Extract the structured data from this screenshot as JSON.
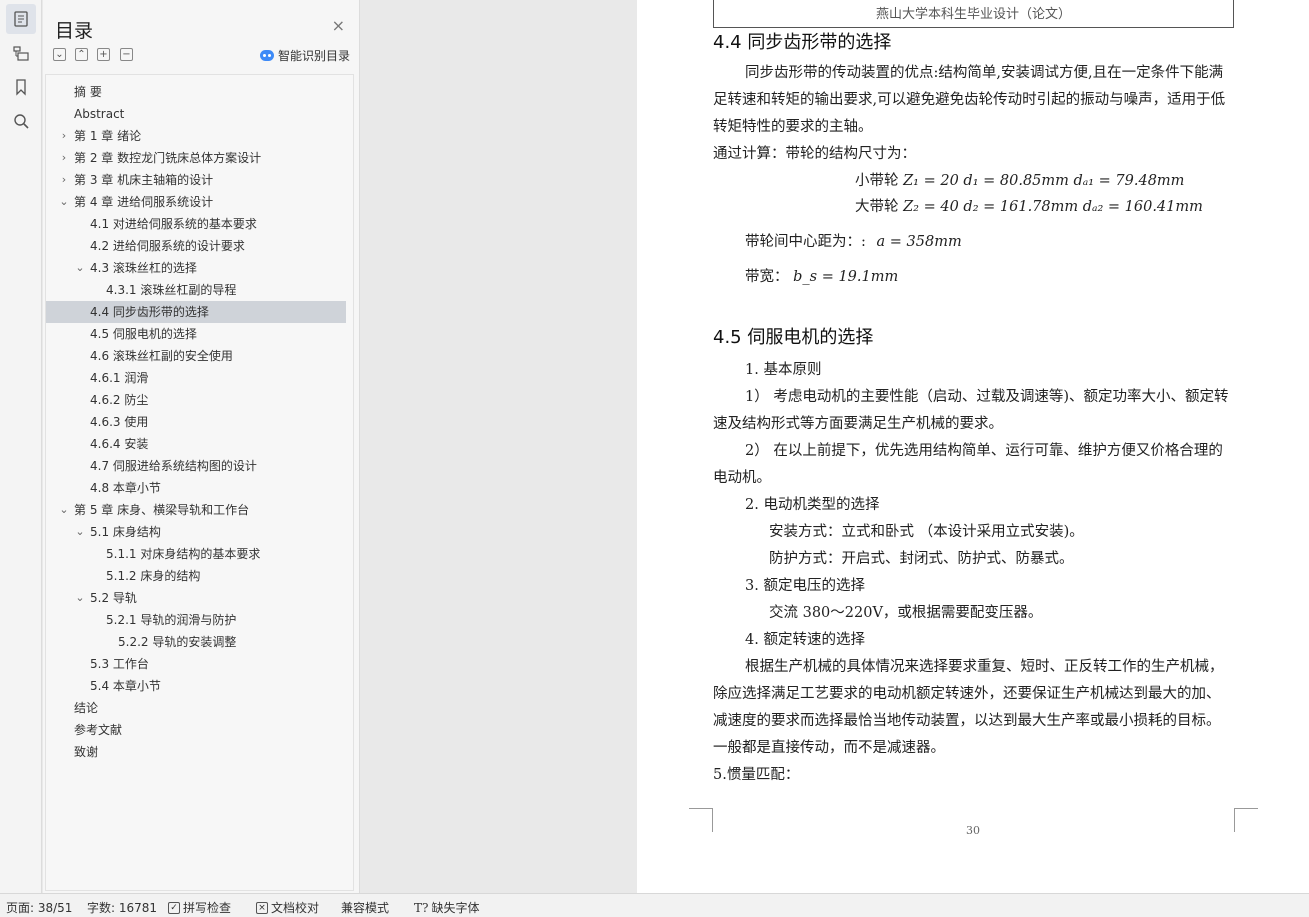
{
  "sidebar_rail": {
    "icons": [
      "outline-icon",
      "navigation-pane-icon",
      "bookmark-icon",
      "search-icon"
    ]
  },
  "toc": {
    "title": "目录",
    "close_glyph": "×",
    "tools": [
      "⌄",
      "⌃",
      "+",
      "−"
    ],
    "smart_label": "智能识别目录",
    "items": [
      {
        "label": "摘  要",
        "level": 0,
        "caret": ""
      },
      {
        "label": "Abstract",
        "level": 0,
        "caret": ""
      },
      {
        "label": "第 1 章   绪论",
        "level": 0,
        "caret": "›"
      },
      {
        "label": "第 2 章   数控龙门铣床总体方案设计",
        "level": 0,
        "caret": "›"
      },
      {
        "label": "第 3 章  机床主轴箱的设计",
        "level": 0,
        "caret": "›"
      },
      {
        "label": "第 4 章  进给伺服系统设计",
        "level": 0,
        "caret": "⌄"
      },
      {
        "label": "4.1  对进给伺服系统的基本要求",
        "level": 1,
        "caret": ""
      },
      {
        "label": "4.2 进给伺服系统的设计要求",
        "level": 1,
        "caret": ""
      },
      {
        "label": "4.3 滚珠丝杠的选择",
        "level": 1,
        "caret": "⌄"
      },
      {
        "label": "4.3.1  滚珠丝杠副的导程",
        "level": 2,
        "caret": ""
      },
      {
        "label": "4.4 同步齿形带的选择",
        "level": 1,
        "caret": "",
        "selected": true
      },
      {
        "label": "4.5 伺服电机的选择",
        "level": 1,
        "caret": ""
      },
      {
        "label": "4.6  滚珠丝杠副的安全使用",
        "level": 1,
        "caret": ""
      },
      {
        "label": "4.6.1  润滑",
        "level": 1,
        "caret": ""
      },
      {
        "label": "4.6.2  防尘",
        "level": 1,
        "caret": ""
      },
      {
        "label": "4.6.3 使用",
        "level": 1,
        "caret": ""
      },
      {
        "label": "4.6.4  安装",
        "level": 1,
        "caret": ""
      },
      {
        "label": "4.7  伺服进给系统结构图的设计",
        "level": 1,
        "caret": ""
      },
      {
        "label": "4.8  本章小节",
        "level": 1,
        "caret": ""
      },
      {
        "label": "第 5 章  床身、横梁导轨和工作台",
        "level": 0,
        "caret": "⌄"
      },
      {
        "label": "5.1  床身结构",
        "level": 1,
        "caret": "⌄"
      },
      {
        "label": "5.1.1  对床身结构的基本要求",
        "level": 2,
        "caret": ""
      },
      {
        "label": "5.1.2  床身的结构",
        "level": 2,
        "caret": ""
      },
      {
        "label": "5.2  导轨",
        "level": 1,
        "caret": "⌄"
      },
      {
        "label": "5.2.1  导轨的润滑与防护",
        "level": 2,
        "caret": ""
      },
      {
        "label": "5.2.2  导轨的安装调整",
        "level": 3,
        "caret": ""
      },
      {
        "label": "5.3  工作台",
        "level": 1,
        "caret": ""
      },
      {
        "label": "5.4  本章小节",
        "level": 1,
        "caret": ""
      },
      {
        "label": "结论",
        "level": 0,
        "caret": ""
      },
      {
        "label": "参考文献",
        "level": 0,
        "caret": ""
      },
      {
        "label": "致谢",
        "level": 0,
        "caret": ""
      }
    ]
  },
  "page": {
    "header": "燕山大学本科生毕业设计（论文）",
    "h_44": "4.4 同步齿形带的选择",
    "p_44_1": "同步齿形带的传动装置的优点:结构简单,安装调试方便,且在一定条件下能满足转速和转矩的输出要求,可以避免避免齿轮传动时引起的振动与噪声，适用于低转矩特性的要求的主轴。",
    "p_44_2": "通过计算：带轮的结构尺寸为：",
    "f1_label": "小带轮",
    "f1_math": "Z₁ = 20   d₁ = 80.85mm   dₐ₁ = 79.48mm",
    "f2_label": "大带轮",
    "f2_math": "Z₂ = 40   d₂ = 161.78mm   dₐ₂ = 160.41mm",
    "center_label": "带轮间中心距为：:",
    "center_math": "a = 358mm",
    "width_label": "带宽：",
    "width_math": "b_s = 19.1mm",
    "h_45": "4.5 伺服电机的选择",
    "l1": "1.  基本原则",
    "l2": "1）  考虑电动机的主要性能（启动、过载及调速等)、额定功率大小、额定转速及结构形式等方面要满足生产机械的要求。",
    "l3": "2）  在以上前提下，优先选用结构简单、运行可靠、维护方便又价格合理的电动机。",
    "l4": "2.  电动机类型的选择",
    "l5": "安装方式：立式和卧式  （本设计采用立式安装)。",
    "l6": "防护方式：开启式、封闭式、防护式、防暴式。",
    "l7": "3.  额定电压的选择",
    "l8": "交流 380～220V，或根据需要配变压器。",
    "l9": "4.  额定转速的选择",
    "l10": "根据生产机械的具体情况来选择要求重复、短时、正反转工作的生产机械，除应选择满足工艺要求的电动机额定转速外，还要保证生产机械达到最大的加、减速度的要求而选择最恰当地传动装置，以达到最大生产率或最小损耗的目标。一般都是直接传动，而不是减速器。",
    "l11": "5.惯量匹配：",
    "page_number": "30"
  },
  "status": {
    "page": "页面: 38/51",
    "words": "字数: 16781",
    "spell": "拼写检查",
    "proof": "文档校对",
    "compat": "兼容模式",
    "font": "缺失字体"
  }
}
